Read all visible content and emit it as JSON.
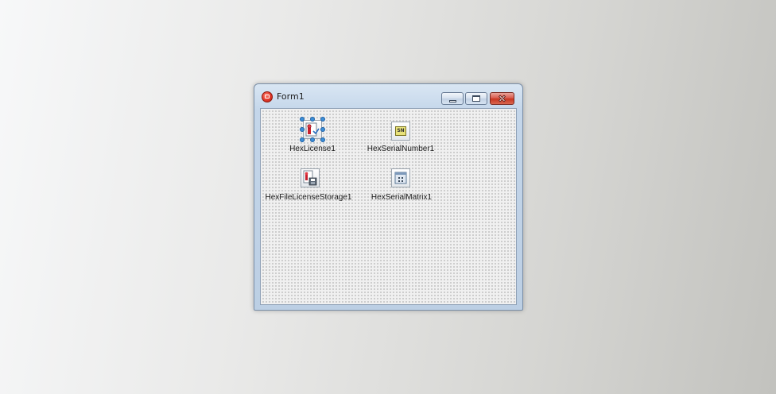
{
  "window": {
    "title": "Form1"
  },
  "components": [
    {
      "name": "HexLicense1",
      "icon": "license-icon",
      "selected": true
    },
    {
      "name": "HexSerialNumber1",
      "icon": "serial-number-icon",
      "badge": "SN",
      "selected": false
    },
    {
      "name": "HexFileLicenseStorage1",
      "icon": "license-storage-icon",
      "selected": false
    },
    {
      "name": "HexSerialMatrix1",
      "icon": "serial-matrix-icon",
      "selected": false
    }
  ],
  "colors": {
    "title_bar": "#c4d6ea",
    "close_button": "#c7341f",
    "selection_handle": "#3c8fd8",
    "designer_grid": "#f0f0f0"
  }
}
